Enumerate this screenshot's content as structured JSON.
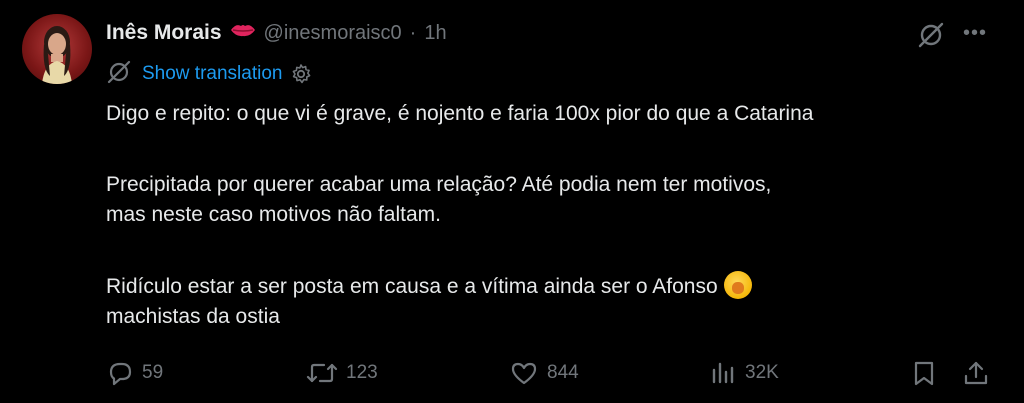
{
  "author": {
    "name": "Inês Morais",
    "handle": "@inesmoraisc0",
    "time": "1h",
    "emoji_icon": "kiss-mark-lips"
  },
  "translate": {
    "label": "Show translation"
  },
  "tweet": {
    "paragraphs": [
      "Digo e repito: o que vi é grave, é nojento e faria 100x pior do que a Catarina",
      "Precipitada por querer acabar uma relação? Até podia nem ter motivos,",
      "mas neste caso motivos não faltam.",
      "Ridículo estar a ser posta em causa e a vítima ainda ser o Afonso",
      "machistas da ostia"
    ],
    "emoji": "yawning-face"
  },
  "actions": {
    "replies": "59",
    "reposts": "123",
    "likes": "844",
    "views": "32K"
  },
  "colors": {
    "background": "#000000",
    "text": "#e7e9ea",
    "secondary": "#71767b",
    "link": "#1d9bf0"
  }
}
